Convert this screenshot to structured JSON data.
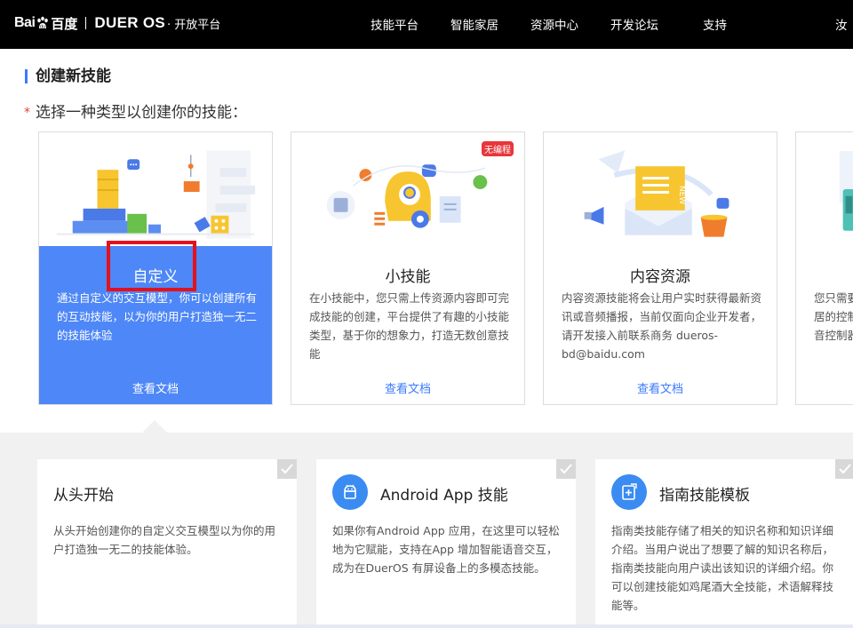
{
  "brand": {
    "baidu": "Bai",
    "baidu_cn": "百度",
    "dueros": "DUER OS",
    "suffix": "· 开放平台"
  },
  "nav": [
    "技能平台",
    "智能家居",
    "资源中心",
    "开发论坛",
    "支持",
    "汝"
  ],
  "section_title": "创建新技能",
  "subtitle": {
    "required_mark": "*",
    "text": "选择一种类型以创建你的技能："
  },
  "skill_types": [
    {
      "title": "自定义",
      "desc": "通过自定义的交互模型，你可以创建所有的互动技能，以为你的用户打造独一无二的技能体验",
      "link": "查看文档",
      "selected": true
    },
    {
      "title": "小技能",
      "desc": "在小技能中，您只需上传资源内容即可完成技能的创建，平台提供了有趣的小技能类型，基于你的想象力，打造无数创意技能",
      "link": "查看文档",
      "badge": "无编程"
    },
    {
      "title": "内容资源",
      "desc": "内容资源技能将会让用户实时获得最新资讯或音频播报，当前仅面向企业开发者，请开发接入前联系商务 dueros-bd@baidu.com",
      "link": "查看文档",
      "illustration_text": "NEW"
    },
    {
      "title": "",
      "desc": "您只需要居的控制音控制器",
      "link": ""
    }
  ],
  "templates": [
    {
      "title": "从头开始",
      "desc": "从头开始创建你的自定义交互模型以为你的用户打造独一无二的技能体验。"
    },
    {
      "title": "Android App 技能",
      "icon": "android-icon",
      "desc": "如果你有Android App 应用，在这里可以轻松地为它赋能，支持在App 增加智能语音交互，成为在DuerOS 有屏设备上的多模态技能。"
    },
    {
      "title": "指南技能模板",
      "icon": "guide-icon",
      "desc": "指南类技能存储了相关的知识名称和知识详细介绍。当用户说出了想要了解的知识名称后，指南类技能向用户读出该知识的详细介绍。你可以创建技能如鸡尾酒大全技能，术语解释技能等。"
    }
  ],
  "colors": {
    "accent": "#3a7afe",
    "selected_card": "#4e87f7",
    "highlight": "#e3111b",
    "topbar": "#000000"
  }
}
